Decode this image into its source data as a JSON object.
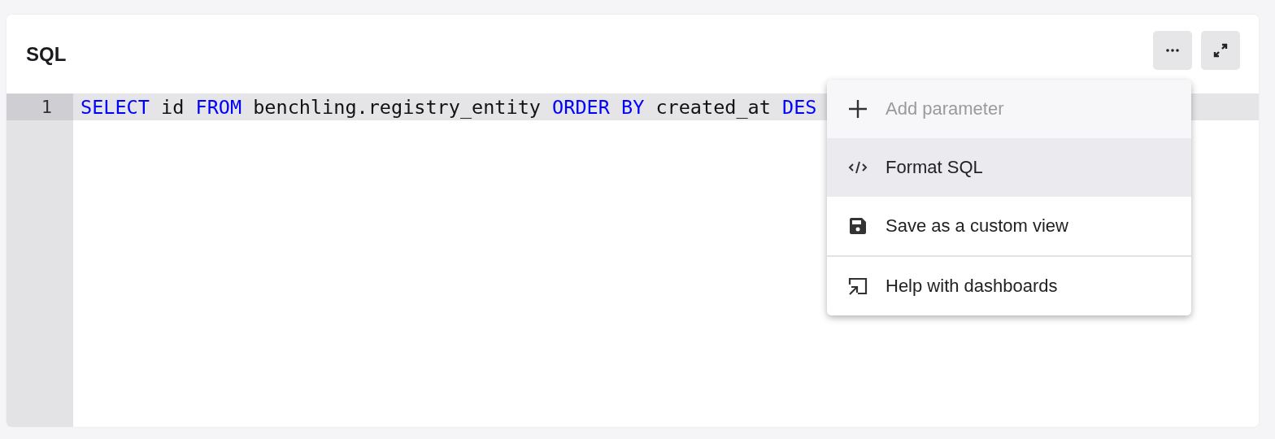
{
  "panel": {
    "title": "SQL"
  },
  "toolbar": [
    {
      "kind": "more"
    },
    {
      "kind": "expand"
    }
  ],
  "editor": {
    "lines": [
      {
        "number": "1",
        "highlighted": true,
        "tokens": [
          {
            "text": "SELECT",
            "kind": "keyword"
          },
          {
            "text": " id ",
            "kind": "plain"
          },
          {
            "text": "FROM",
            "kind": "keyword"
          },
          {
            "text": " benchling.registry_entity ",
            "kind": "plain"
          },
          {
            "text": "ORDER BY",
            "kind": "keyword"
          },
          {
            "text": " created_at ",
            "kind": "plain"
          },
          {
            "text": "DES",
            "kind": "keyword"
          }
        ]
      }
    ]
  },
  "menu": {
    "items": [
      {
        "label": "Add parameter",
        "kind": "plus",
        "disabled": true,
        "selected": false,
        "divider_after": false
      },
      {
        "label": "Format SQL",
        "kind": "code",
        "disabled": false,
        "selected": true,
        "divider_after": false
      },
      {
        "label": "Save as a custom view",
        "kind": "save",
        "disabled": false,
        "selected": false,
        "divider_after": true
      },
      {
        "label": "Help with dashboards",
        "kind": "help",
        "disabled": false,
        "selected": false,
        "divider_after": false
      }
    ]
  }
}
